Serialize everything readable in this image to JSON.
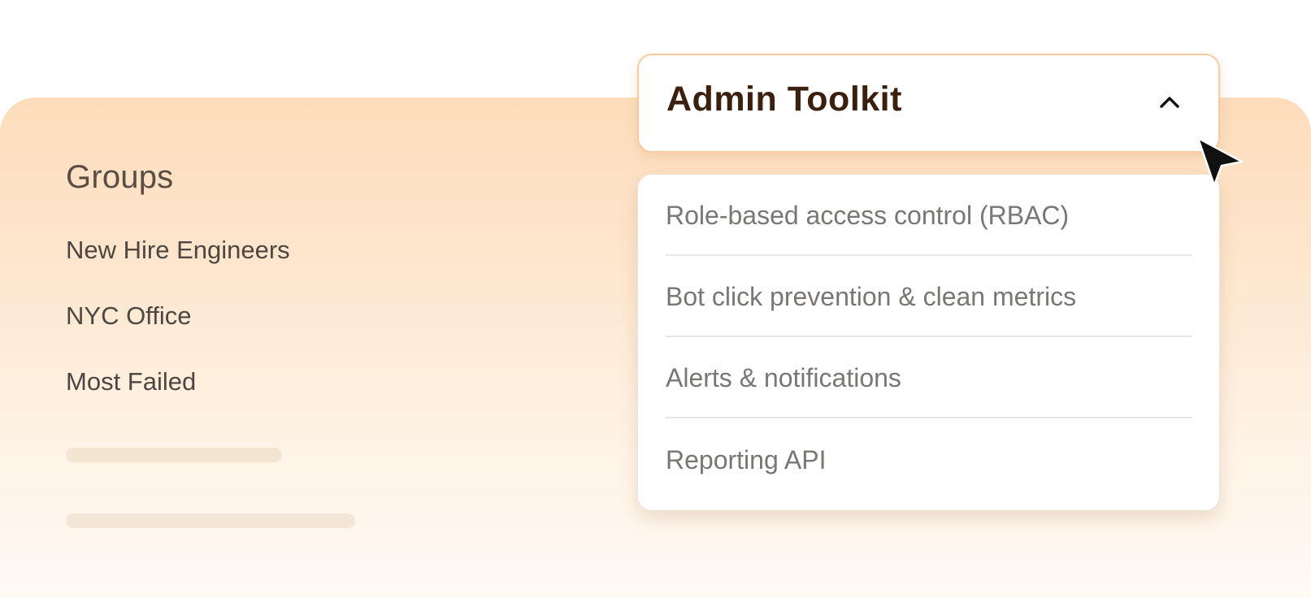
{
  "groups": {
    "title": "Groups",
    "items": [
      {
        "label": "New Hire Engineers"
      },
      {
        "label": "NYC Office"
      },
      {
        "label": "Most Failed"
      }
    ]
  },
  "toolkit": {
    "title": "Admin Toolkit",
    "expanded": true,
    "chevron_icon": "chevron-up-icon",
    "items": [
      {
        "label": "Role-based access control (RBAC)"
      },
      {
        "label": "Bot click prevention & clean metrics"
      },
      {
        "label": "Alerts & notifications"
      },
      {
        "label": "Reporting API"
      }
    ]
  },
  "colors": {
    "panel_gradient_top": "#fddcba",
    "panel_gradient_bottom": "#fffaf4",
    "header_border": "#f9c9a0",
    "title_text": "#3b1f0f",
    "menu_text": "#7a7673"
  },
  "cursor_icon": "mouse-pointer-icon"
}
